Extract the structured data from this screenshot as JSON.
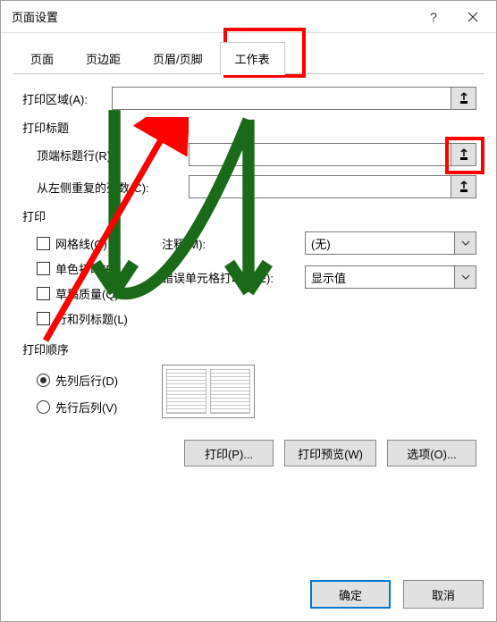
{
  "titlebar": {
    "title": "页面设置"
  },
  "tabs": [
    {
      "label": "页面",
      "active": false
    },
    {
      "label": "页边距",
      "active": false
    },
    {
      "label": "页眉/页脚",
      "active": false
    },
    {
      "label": "工作表",
      "active": true
    }
  ],
  "print_area": {
    "label": "打印区域(A):",
    "value": ""
  },
  "print_titles": {
    "section": "打印标题",
    "top_rows_label": "顶端标题行(R):",
    "top_rows_value": "",
    "left_cols_label": "从左侧重复的列数(C):",
    "left_cols_value": ""
  },
  "print_section": {
    "title": "打印",
    "checkboxes": [
      {
        "label": "网格线(G)",
        "checked": false
      },
      {
        "label": "单色打印(B)",
        "checked": false
      },
      {
        "label": "草稿质量(Q)",
        "checked": false
      },
      {
        "label": "行和列标题(L)",
        "checked": false
      }
    ],
    "comments_label": "注释(M):",
    "comments_value": "(无)",
    "errors_label": "错误单元格打印为(E):",
    "errors_value": "显示值"
  },
  "order_section": {
    "title": "打印顺序",
    "radios": [
      {
        "label": "先列后行(D)",
        "checked": true
      },
      {
        "label": "先行后列(V)",
        "checked": false
      }
    ]
  },
  "action_buttons": {
    "print": "打印(P)...",
    "preview": "打印预览(W)",
    "options": "选项(O)..."
  },
  "footer": {
    "ok": "确定",
    "cancel": "取消"
  }
}
